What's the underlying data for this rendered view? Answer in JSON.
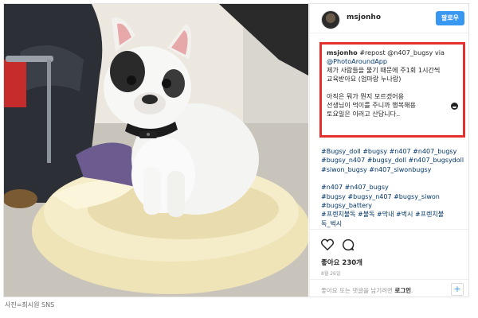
{
  "post": {
    "username": "msjonho",
    "follow_label": "팔로우",
    "caption": {
      "username": "msjonho",
      "line1_rest": " #repost @n407_bugsy via",
      "line2": "@PhotoAroundApp",
      "line3": "제가 사람들을 물기 때문에 주1회 1시간씩",
      "line4": "교육받아요 (엄마랑 누나랑)",
      "line5": "아직은 뭐가 뭔지 모르겠어용",
      "line6": "선생님이 먹이를 주니까 행복해용",
      "line7": "토요일은 이러고 산답니다.."
    },
    "hashtags": [
      "#Bugsy_doll #bugsy #n407 #n407_bugsy",
      "#bugsy_n407 #bugsy_doll #n407_bugsydoll",
      "#siwon_bugsy #n407_siwonbugsy"
    ],
    "hashtags2": [
      "#n407 #n407_bugsy",
      "#bugsy #bugsy_n407 #bugsy_siwon",
      "#bugsy_battery",
      "#프렌치불독 #불독 #막내 #벅시 #프렌치불",
      "독_벅시"
    ],
    "likes": "좋아요 230개",
    "date": "8월 26일",
    "comment_prompt_prefix": "좋아요 또는 댓글을 남기려면 ",
    "comment_prompt_link": "로그인",
    "comment_prompt_suffix": ".",
    "more_label": "+"
  },
  "credit": "사진=최시원 SNS",
  "icons": [
    "heart-icon",
    "comment-icon",
    "more-options-icon",
    "smile-emoji-icon"
  ],
  "colors": {
    "follow_button": "#3897f0",
    "highlight_box": "#e53030",
    "hashtag": "#003569"
  }
}
